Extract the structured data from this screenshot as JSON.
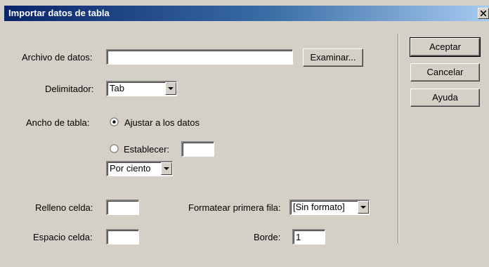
{
  "window": {
    "title": "Importar datos de tabla",
    "close_icon": "close-x-icon"
  },
  "form": {
    "archivo_label": "Archivo de datos:",
    "archivo_value": "",
    "examinar_label": "Examinar...",
    "delimitador_label": "Delimitador:",
    "delimitador_value": "Tab",
    "ancho_label": "Ancho de tabla:",
    "ajustar_label": "Ajustar a los datos",
    "ajustar_checked": true,
    "establecer_label": "Establecer:",
    "establecer_value": "",
    "unidad_value": "Por ciento",
    "relleno_label": "Relleno celda:",
    "relleno_value": "",
    "espacio_label": "Espacio celda:",
    "espacio_value": "",
    "formatear_label": "Formatear primera fila:",
    "formatear_value": "[Sin formato]",
    "borde_label": "Borde:",
    "borde_value": "1"
  },
  "buttons": {
    "aceptar": "Aceptar",
    "cancelar": "Cancelar",
    "ayuda": "Ayuda"
  },
  "colors": {
    "title_start": "#0a246a",
    "title_end": "#a6caf0",
    "face": "#d4d0c8"
  }
}
